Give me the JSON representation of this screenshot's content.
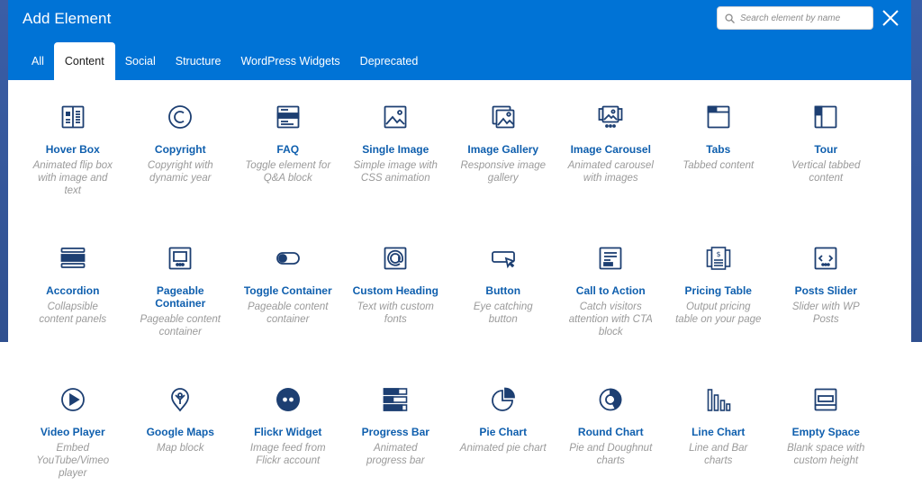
{
  "header": {
    "title": "Add Element",
    "search_placeholder": "Search element by name"
  },
  "tabs": [
    {
      "label": "All",
      "active": false
    },
    {
      "label": "Content",
      "active": true
    },
    {
      "label": "Social",
      "active": false
    },
    {
      "label": "Structure",
      "active": false
    },
    {
      "label": "WordPress Widgets",
      "active": false
    },
    {
      "label": "Deprecated",
      "active": false
    }
  ],
  "colors": {
    "header_bg": "#0073d6",
    "icon": "#1d3f72",
    "name": "#0f5fae",
    "desc": "#9a9a9a"
  },
  "elements": [
    {
      "name": "Hover Box",
      "desc": "Animated flip box with image and text",
      "icon": "hover-box-icon"
    },
    {
      "name": "Copyright",
      "desc": "Copyright with dynamic year",
      "icon": "copyright-icon"
    },
    {
      "name": "FAQ",
      "desc": "Toggle element for Q&A block",
      "icon": "faq-icon"
    },
    {
      "name": "Single Image",
      "desc": "Simple image with CSS animation",
      "icon": "single-image-icon"
    },
    {
      "name": "Image Gallery",
      "desc": "Responsive image gallery",
      "icon": "image-gallery-icon"
    },
    {
      "name": "Image Carousel",
      "desc": "Animated carousel with images",
      "icon": "image-carousel-icon"
    },
    {
      "name": "Tabs",
      "desc": "Tabbed content",
      "icon": "tabs-icon"
    },
    {
      "name": "Tour",
      "desc": "Vertical tabbed content",
      "icon": "tour-icon"
    },
    {
      "name": "Accordion",
      "desc": "Collapsible content panels",
      "icon": "accordion-icon"
    },
    {
      "name": "Pageable Container",
      "desc": "Pageable content container",
      "icon": "pageable-container-icon"
    },
    {
      "name": "Toggle Container",
      "desc": "Pageable content container",
      "icon": "toggle-container-icon"
    },
    {
      "name": "Custom Heading",
      "desc": "Text with custom fonts",
      "icon": "custom-heading-icon"
    },
    {
      "name": "Button",
      "desc": "Eye catching button",
      "icon": "button-icon"
    },
    {
      "name": "Call to Action",
      "desc": "Catch visitors attention with CTA block",
      "icon": "call-to-action-icon"
    },
    {
      "name": "Pricing Table",
      "desc": "Output pricing table on your page",
      "icon": "pricing-table-icon"
    },
    {
      "name": "Posts Slider",
      "desc": "Slider with WP Posts",
      "icon": "posts-slider-icon"
    },
    {
      "name": "Video Player",
      "desc": "Embed YouTube/Vimeo player",
      "icon": "video-player-icon"
    },
    {
      "name": "Google Maps",
      "desc": "Map block",
      "icon": "google-maps-icon"
    },
    {
      "name": "Flickr Widget",
      "desc": "Image feed from Flickr account",
      "icon": "flickr-widget-icon"
    },
    {
      "name": "Progress Bar",
      "desc": "Animated progress bar",
      "icon": "progress-bar-icon"
    },
    {
      "name": "Pie Chart",
      "desc": "Animated pie chart",
      "icon": "pie-chart-icon"
    },
    {
      "name": "Round Chart",
      "desc": "Pie and Doughnut charts",
      "icon": "round-chart-icon"
    },
    {
      "name": "Line Chart",
      "desc": "Line and Bar charts",
      "icon": "line-chart-icon"
    },
    {
      "name": "Empty Space",
      "desc": "Blank space with custom height",
      "icon": "empty-space-icon"
    }
  ]
}
